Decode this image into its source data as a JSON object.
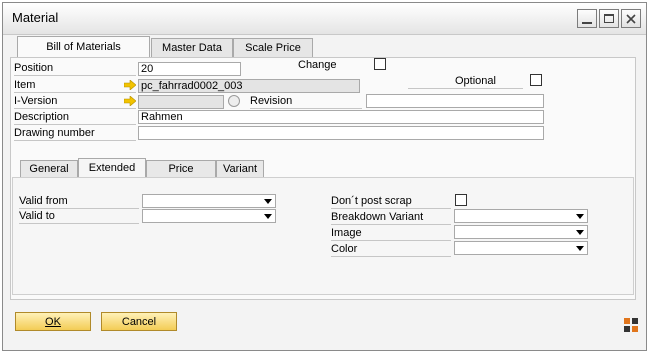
{
  "window": {
    "title": "Material"
  },
  "main_tabs": [
    {
      "label": "Bill of Materials",
      "active": true
    },
    {
      "label": "Master Data",
      "active": false
    },
    {
      "label": "Scale Price",
      "active": false
    }
  ],
  "form": {
    "position_label": "Position",
    "position_value": "20",
    "change_label": "Change",
    "item_label": "Item",
    "item_value": "pc_fahrrad0002_003",
    "optional_label": "Optional",
    "iversion_label": "I-Version",
    "iversion_value": "",
    "revision_label": "Revision",
    "revision_value": "",
    "description_label": "Description",
    "description_value": "Rahmen",
    "drawing_label": "Drawing number",
    "drawing_value": ""
  },
  "inner_tabs": [
    {
      "label": "General",
      "active": false
    },
    {
      "label": "Extended",
      "active": true
    },
    {
      "label": "Price",
      "active": false
    },
    {
      "label": "Variant",
      "active": false
    }
  ],
  "extended": {
    "valid_from_label": "Valid from",
    "valid_to_label": "Valid to",
    "dont_post_scrap_label": "Don´t post scrap",
    "breakdown_variant_label": "Breakdown Variant",
    "image_label": "Image",
    "color_label": "Color"
  },
  "buttons": {
    "ok_label": "OK",
    "cancel_label": "Cancel"
  },
  "colors": {
    "link_arrow": "#f2c300",
    "button_fill": "#f3cc55"
  }
}
